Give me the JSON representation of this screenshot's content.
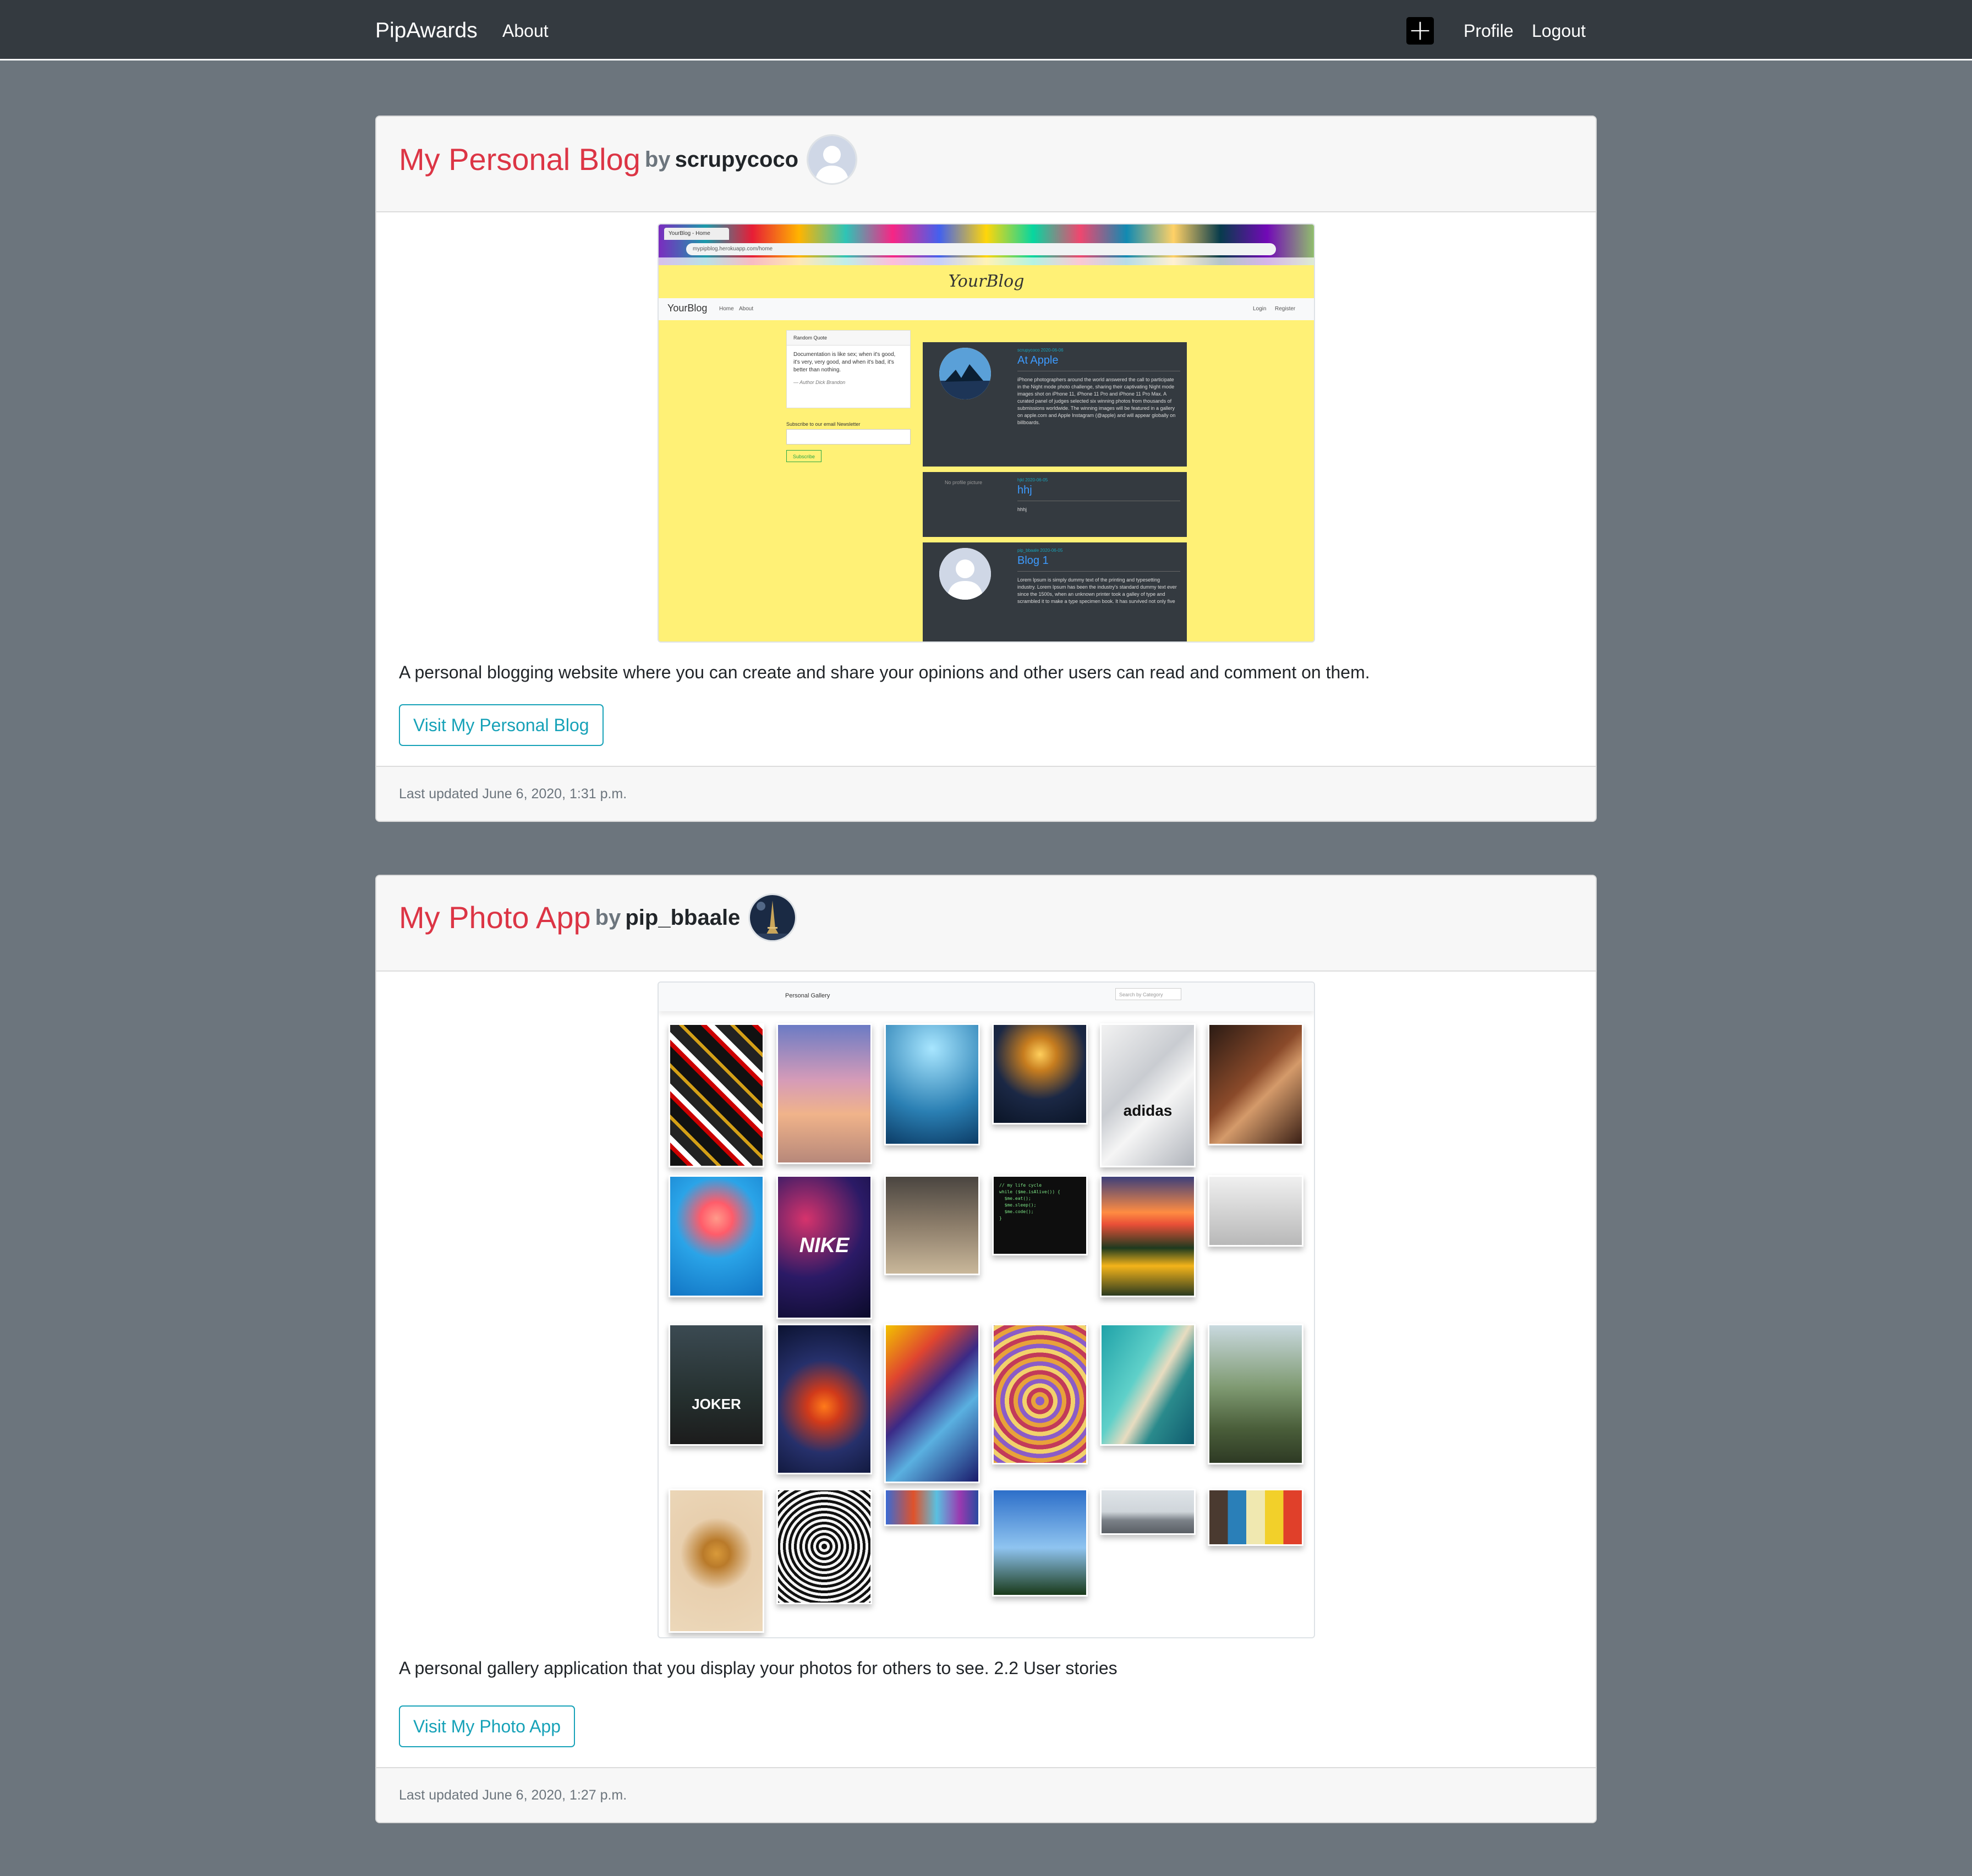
{
  "navbar": {
    "brand": "PipAwards",
    "about": "About",
    "add_icon": "plus-square-icon",
    "profile": "Profile",
    "logout": "Logout"
  },
  "projects": [
    {
      "title": "My Personal Blog",
      "by": "by",
      "author": "scrupycoco",
      "description": "A personal blogging website where you can create and share your opinions and other users can read and comment on them.",
      "button": "Visit My Personal Blog",
      "updated": "Last updated June 6, 2020, 1:31 p.m.",
      "screenshot": {
        "tab_title": "YourBlog - Home",
        "url": "mypipblog.herokuapp.com/home",
        "hero": "YourBlog",
        "brand": "YourBlog",
        "nav_home": "Home",
        "nav_about": "About",
        "nav_login": "Login",
        "nav_register": "Register",
        "quote_title": "Random Quote",
        "quote_text": "Documentation is like sex; when it's good, it's very, very good, and when it's bad, it's better than nothing.",
        "quote_author": "— Author Dick Brandon",
        "subscribe_label": "Subscribe to our email Newsletter",
        "subscribe_button": "Subscribe",
        "posts": [
          {
            "meta": "scrupycoco  2020-06-06",
            "title": "At Apple",
            "body": "iPhone photographers around the world answered the call to participate in the Night mode photo challenge, sharing their captivating Night mode images shot on iPhone 11, iPhone 11 Pro and iPhone 11 Pro Max. A curated panel of judges selected six winning photos from thousands of submissions worldwide. The winning images will be featured in a gallery on apple.com and Apple Instagram (@apple) and will appear globally on billboards."
          },
          {
            "meta": "hjkl  2020-06-05",
            "title": "hhj",
            "body": "hhhj",
            "no_pic": "No profile picture"
          },
          {
            "meta": "pip_bbaale  2020-06-05",
            "title": "Blog 1",
            "body": "Lorem Ipsum is simply dummy text of the printing and typesetting industry. Lorem Ipsum has been the industry's standard dummy text ever since the 1500s, when an unknown printer took a galley of type and scrambled it to make a type specimen book. It has survived not only five"
          }
        ]
      }
    },
    {
      "title": "My Photo App",
      "by": "by",
      "author": "pip_bbaale",
      "description": "A personal gallery application that you display your photos for others to see. 2.2 User stories",
      "button": "Visit My Photo App",
      "updated": "Last updated June 6, 2020, 1:27 p.m.",
      "screenshot": {
        "title": "Personal Gallery",
        "search_placeholder": "Search by Category",
        "tile_labels": {
          "nike": "NIKE",
          "adidas": "adidas",
          "joker": "JOKER",
          "code": "// my life cycle\nwhile ($me.isAlive()) {\n  $me.eat();\n  $me.sleep();\n  $me.code();\n}"
        }
      }
    }
  ],
  "colors": {
    "page_bg": "#6c757d",
    "navbar_bg": "#343a40",
    "title_red": "#dc3545",
    "button_teal": "#17a2b8"
  }
}
